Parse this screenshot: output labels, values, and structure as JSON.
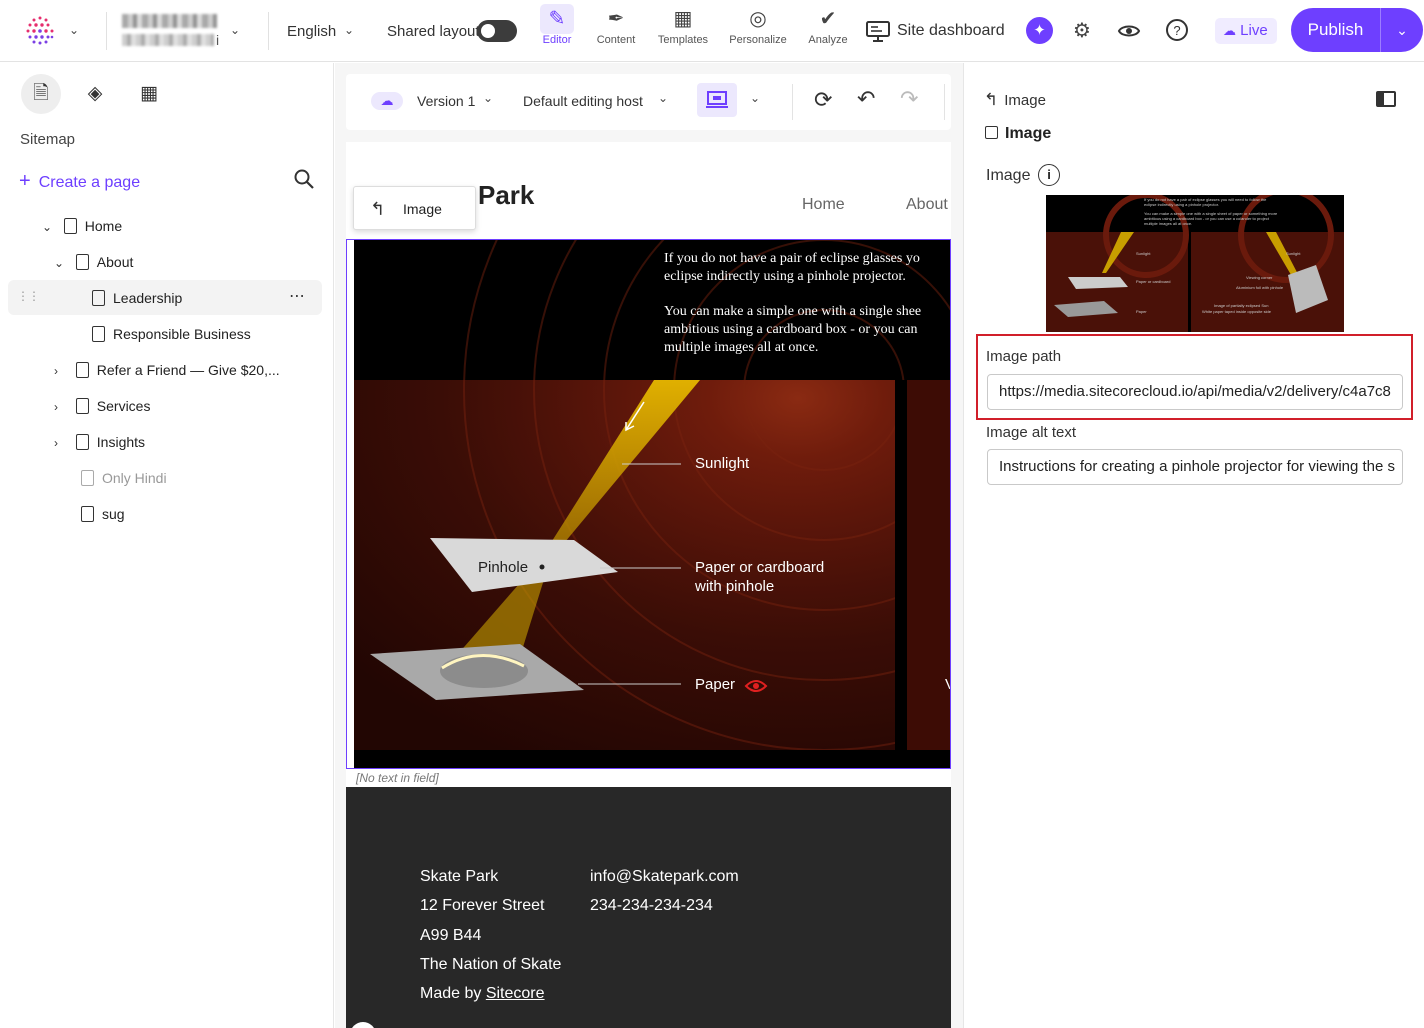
{
  "topbar": {
    "account_suffix": "i",
    "language": "English",
    "shared_layout": "Shared layout",
    "nav": [
      {
        "label": "Editor",
        "icon": "editor-icon"
      },
      {
        "label": "Content",
        "icon": "content-feather-icon"
      },
      {
        "label": "Templates",
        "icon": "templates-grid-icon"
      },
      {
        "label": "Personalize",
        "icon": "personalize-target-icon"
      },
      {
        "label": "Analyze",
        "icon": "analyze-chart-icon"
      }
    ],
    "site_dashboard": "Site dashboard",
    "live": "Live",
    "publish": "Publish"
  },
  "sidebar": {
    "section": "Sitemap",
    "create": "Create a page",
    "tree": [
      {
        "label": "Home"
      },
      {
        "label": "About"
      },
      {
        "label": "Leadership"
      },
      {
        "label": "Responsible Business"
      },
      {
        "label": "Refer a Friend — Give $20,..."
      },
      {
        "label": "Services"
      },
      {
        "label": "Insights"
      },
      {
        "label": "Only Hindi"
      },
      {
        "label": "sug"
      }
    ]
  },
  "toolbar": {
    "version": "Version 1",
    "host": "Default editing host"
  },
  "page": {
    "title_partial": "Park",
    "nav": [
      "Home",
      "About"
    ],
    "image_chip": "Image",
    "image_text_1": "If you do not have a pair of eclipse glasses yo",
    "image_text_2": "eclipse indirectly using a pinhole projector.",
    "image_text_3": "You can make a simple one with a single shee",
    "image_text_4": "ambitious using a cardboard box - or you can",
    "image_text_5": "multiple images all at once.",
    "labels": {
      "sunlight": "Sunlight",
      "pinhole": "Pinhole",
      "paper_cardboard_1": "Paper or cardboard",
      "paper_cardboard_2": "with pinhole",
      "paper": "Paper",
      "cut": "V"
    },
    "no_text": "[No text in field]",
    "footer": {
      "col1": [
        "Skate Park",
        "12 Forever Street",
        "A99 B44",
        "The Nation of Skate"
      ],
      "made_by": "Made by",
      "made_by_link": "Sitecore",
      "col2": [
        "info@Skatepark.com",
        "234-234-234-234"
      ]
    }
  },
  "panel": {
    "breadcrumb": "Image",
    "title": "Image",
    "image_label": "Image",
    "image_path_label": "Image path",
    "image_path_value": "https://media.sitecorecloud.io/api/media/v2/delivery/c4a7c8",
    "alt_label": "Image alt text",
    "alt_value": "Instructions for creating a pinhole projector for viewing the s"
  },
  "colors": {
    "accent": "#6e3fff",
    "highlight": "#d11f2a",
    "footer": "#282828"
  }
}
